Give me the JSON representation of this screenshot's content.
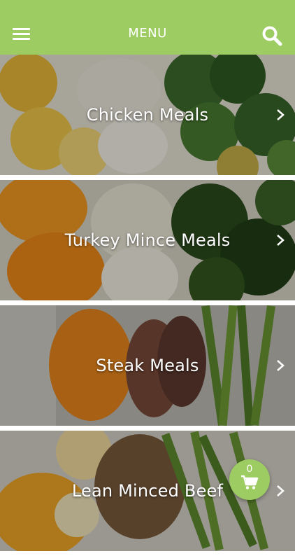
{
  "header": {
    "title": "MENU",
    "menu_icon": "hamburger-icon",
    "search_icon": "search-icon",
    "accent_color": "#9dcc63"
  },
  "categories": [
    {
      "label": "Chicken Meals"
    },
    {
      "label": "Turkey Mince Meals"
    },
    {
      "label": "Steak Meals"
    },
    {
      "label": "Lean Minced Beef"
    }
  ],
  "cart": {
    "count": "0",
    "icon": "cart-icon"
  }
}
